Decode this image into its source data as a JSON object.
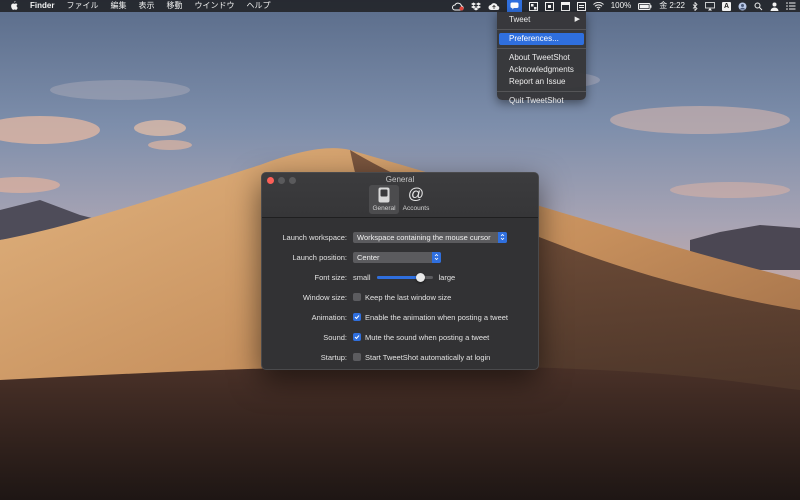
{
  "menubar": {
    "apple_icon": "apple-logo",
    "app_name": "Finder",
    "menus": [
      "ファイル",
      "編集",
      "表示",
      "移動",
      "ウインドウ",
      "ヘルプ"
    ],
    "status_icons": [
      "creative-cloud-icon",
      "dropbox-icon",
      "icloud-upload-icon",
      "tweetshot-icon",
      "grid-icon",
      "display-icon",
      "window-icon",
      "menu-icon",
      "wifi-icon"
    ],
    "battery": "100%",
    "clock": "金 2:22",
    "extra_icons": [
      "bluetooth-icon",
      "airplay-icon",
      "input-source-icon",
      "avatar-icon",
      "spotlight-icon",
      "user-icon",
      "notification-center-icon"
    ],
    "input_source": "A"
  },
  "dropdown": {
    "items": [
      {
        "label": "Tweet",
        "has_submenu": true
      },
      {
        "label": "Preferences...",
        "selected": true
      },
      {
        "label": "About TweetShot"
      },
      {
        "label": "Acknowledgments"
      },
      {
        "label": "Report an Issue"
      },
      {
        "label": "Quit TweetShot"
      }
    ]
  },
  "prefs": {
    "window_title": "General",
    "tabs": [
      {
        "label": "General",
        "icon": "switch-icon",
        "active": true
      },
      {
        "label": "Accounts",
        "icon": "at-icon",
        "active": false
      }
    ],
    "launch_workspace": {
      "label": "Launch workspace:",
      "value": "Workspace containing the mouse cursor"
    },
    "launch_position": {
      "label": "Launch position:",
      "value": "Center"
    },
    "font_size": {
      "label": "Font size:",
      "min_label": "small",
      "max_label": "large",
      "value_fraction": 0.78
    },
    "window_size": {
      "label": "Window size:",
      "text": "Keep the last window size",
      "checked": false
    },
    "animation": {
      "label": "Animation:",
      "text": "Enable the animation when posting a tweet",
      "checked": true
    },
    "sound": {
      "label": "Sound:",
      "text": "Mute the sound when posting a tweet",
      "checked": true
    },
    "startup": {
      "label": "Startup:",
      "text": "Start TweetShot automatically at login",
      "checked": false
    }
  },
  "colors": {
    "accent": "#2f6fde",
    "close_button": "#fc5f57",
    "window_bg": "#323234"
  }
}
